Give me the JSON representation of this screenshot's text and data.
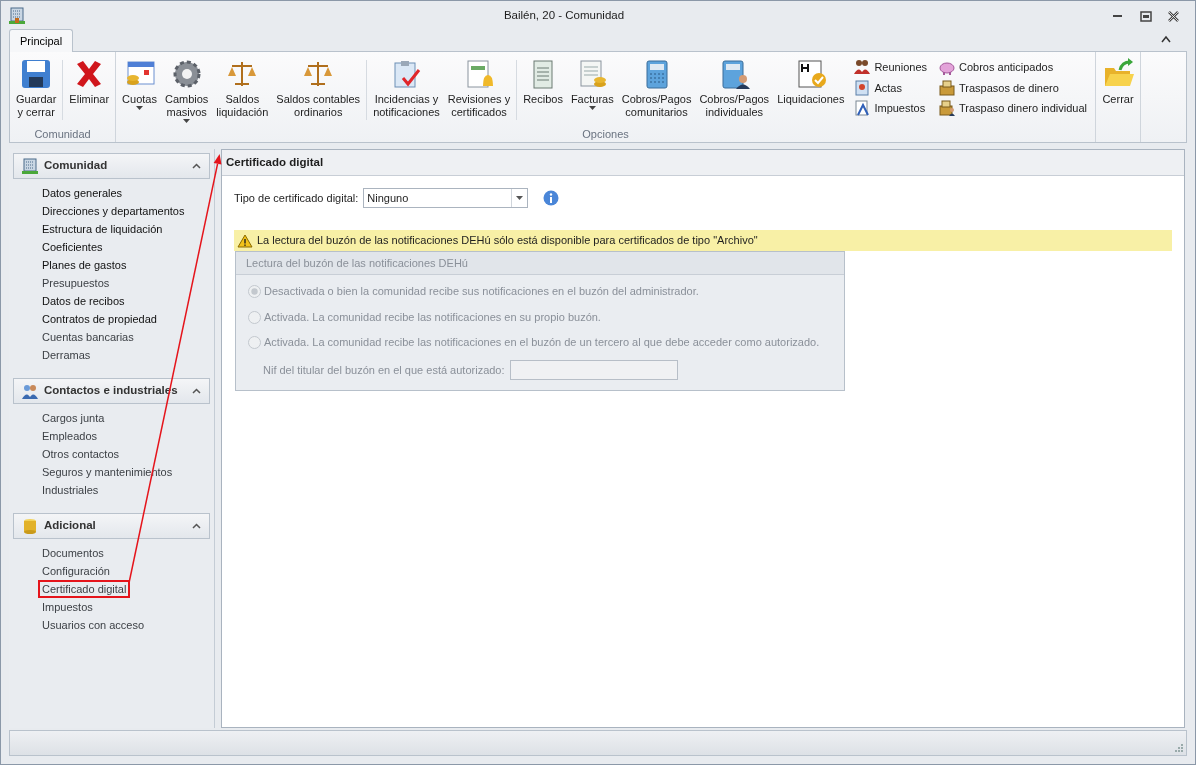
{
  "window": {
    "title": "Bailén, 20 - Comunidad"
  },
  "ribbon": {
    "tabs": [
      {
        "label": "Principal",
        "selected": true
      }
    ],
    "groups": [
      {
        "label": "Comunidad",
        "items": [
          {
            "kind": "large",
            "label": "Guardar\ny cerrar"
          },
          {
            "kind": "separator"
          },
          {
            "kind": "large",
            "label": "Eliminar"
          }
        ]
      },
      {
        "label": "Opciones",
        "items": [
          {
            "kind": "dropdown",
            "label": "Cuotas\n"
          },
          {
            "kind": "dropdown",
            "label": "Cambios\nmasivos"
          },
          {
            "kind": "large",
            "label": "Saldos\nliquidación"
          },
          {
            "kind": "large",
            "label": "Saldos contables\nordinarios"
          },
          {
            "kind": "separator"
          },
          {
            "kind": "large",
            "label": "Incidencias y\nnotificaciones"
          },
          {
            "kind": "large",
            "label": "Revisiones y\ncertificados"
          },
          {
            "kind": "separator"
          },
          {
            "kind": "large",
            "label": "Recibos"
          },
          {
            "kind": "dropdown",
            "label": "Facturas\n"
          },
          {
            "kind": "large",
            "label": "Cobros/Pagos\ncomunitarios"
          },
          {
            "kind": "large",
            "label": "Cobros/Pagos\nindividuales"
          },
          {
            "kind": "large",
            "label": "Liquidaciones"
          },
          {
            "kind": "small",
            "items": [
              {
                "label": "Reuniones"
              },
              {
                "label": "Actas"
              },
              {
                "label": "Impuestos"
              }
            ]
          },
          {
            "kind": "small",
            "items": [
              {
                "label": "Cobros anticipados"
              },
              {
                "label": "Traspasos de dinero"
              },
              {
                "label": "Traspaso dinero individual"
              }
            ]
          }
        ]
      },
      {
        "items": [
          {
            "kind": "large",
            "label": "Cerrar"
          }
        ]
      }
    ]
  },
  "sidebar": [
    {
      "title": "Comunidad",
      "expanded": true,
      "items": [
        {
          "label": "Datos generales",
          "dimmed": false,
          "annotated": false
        },
        {
          "label": "Direcciones y departamentos",
          "dimmed": false,
          "annotated": false
        },
        {
          "label": "Estructura de liquidación",
          "dimmed": false,
          "annotated": false
        },
        {
          "label": "Coeficientes",
          "dimmed": false,
          "annotated": false
        },
        {
          "label": "Planes de gastos",
          "dimmed": false,
          "annotated": false
        },
        {
          "label": "Presupuestos",
          "dimmed": true,
          "annotated": false
        },
        {
          "label": "Datos de recibos",
          "dimmed": false,
          "annotated": false
        },
        {
          "label": "Contratos de propiedad",
          "dimmed": false,
          "annotated": false
        },
        {
          "label": "Cuentas bancarias",
          "dimmed": true,
          "annotated": false
        },
        {
          "label": "Derramas",
          "dimmed": true,
          "annotated": false
        }
      ]
    },
    {
      "title": "Contactos e industriales",
      "expanded": true,
      "items": [
        {
          "label": "Cargos junta",
          "dimmed": true,
          "annotated": false
        },
        {
          "label": "Empleados",
          "dimmed": true,
          "annotated": false
        },
        {
          "label": "Otros contactos",
          "dimmed": true,
          "annotated": false
        },
        {
          "label": "Seguros y mantenimientos",
          "dimmed": true,
          "annotated": false
        },
        {
          "label": "Industriales",
          "dimmed": true,
          "annotated": false
        }
      ]
    },
    {
      "title": "Adicional",
      "expanded": true,
      "items": [
        {
          "label": "Documentos",
          "dimmed": true,
          "annotated": false
        },
        {
          "label": "Configuración",
          "dimmed": true,
          "annotated": false
        },
        {
          "label": "Certificado digital",
          "dimmed": true,
          "annotated": true
        },
        {
          "label": "Impuestos",
          "dimmed": true,
          "annotated": false
        },
        {
          "label": "Usuarios con acceso",
          "dimmed": true,
          "annotated": false
        }
      ]
    }
  ],
  "content": {
    "title": "Certificado digital",
    "certificate_type": {
      "label": "Tipo de certificado digital:",
      "value": "Ninguno"
    },
    "warning": "La lectura del buzón de las notificaciones DEHú sólo está disponible para certificados de tipo \"Archivo\"",
    "mailbox_group": {
      "title": "Lectura del buzón de las notificaciones DEHú",
      "disabled": true,
      "options": [
        {
          "label": "Desactivada o bien la comunidad recibe sus notificaciones en el buzón del administrador.",
          "selected": true
        },
        {
          "label": "Activada. La comunidad recibe las notificaciones en su propio buzón.",
          "selected": false
        },
        {
          "label": "Activada. La comunidad recibe las notificaciones en el buzón de un tercero al que debe acceder como autorizado.",
          "selected": false
        }
      ],
      "nif": {
        "label": "Nif del titular del buzón en el que está autorizado:"
      }
    }
  }
}
